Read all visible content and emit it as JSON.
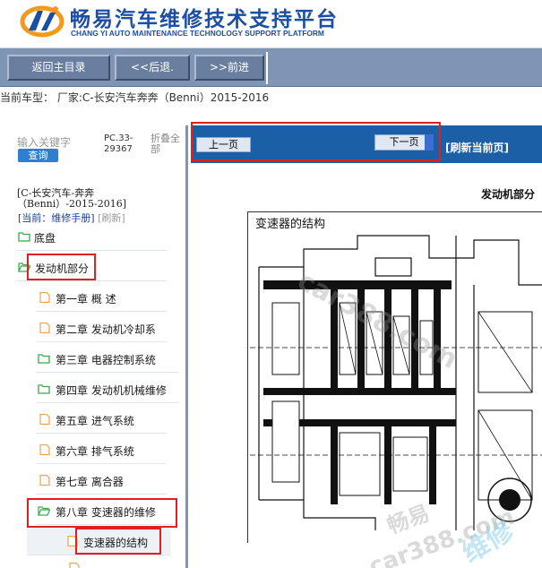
{
  "header": {
    "title": "畅易汽车维修技术支持平台",
    "subtitle": "CHANG YI AUTO MAINTENANCE TECHNOLOGY SUPPORT PLATFORM"
  },
  "toolbar": {
    "home_label": "返回主目录",
    "back_label": "<<后退.",
    "forward_label": ">>前进"
  },
  "vehicle_line": "当前车型： 厂家:C-长安汽车奔奔（Benni）2015-2016",
  "left_panel": {
    "search_placeholder": "输入关键字",
    "search_button": "查询",
    "pc_code": "PC.33-29367",
    "collapse_label": "折叠全部",
    "manual_path": "[C-长安汽车-奔奔（Benni）-2015-2016]",
    "current_label": "[当前：维修手册]",
    "refresh_label": "[刷新]",
    "tree": [
      {
        "label": "底盘",
        "icon": "folder-green-icon"
      },
      {
        "label": "发动机部分",
        "icon": "folder-open-green-icon"
      },
      {
        "label": "第一章 概 述",
        "icon": "page-icon"
      },
      {
        "label": "第二章 发动机冷却系",
        "icon": "page-icon"
      },
      {
        "label": "第三章 电器控制系统",
        "icon": "folder-green-icon"
      },
      {
        "label": "第四章 发动机机械维修",
        "icon": "folder-green-icon"
      },
      {
        "label": "第五章 进气系统",
        "icon": "page-icon"
      },
      {
        "label": "第六章 排气系统",
        "icon": "page-icon"
      },
      {
        "label": "第七章 离合器",
        "icon": "page-icon"
      },
      {
        "label": "第八章 变速器的维修",
        "icon": "folder-open-green-icon"
      },
      {
        "label": "变速器的结构",
        "icon": "page-icon"
      }
    ]
  },
  "right_panel": {
    "prev_label": "上一页",
    "next_label": "下一页",
    "refresh_label": "[刷新当前页]",
    "section_heading": "发动机部分",
    "page_title": "变速器的结构"
  },
  "watermarks": [
    "car388.com",
    "畅易",
    "car388.com",
    "维修"
  ],
  "colors": {
    "brand_blue": "#1b4fa6",
    "toolbar": "#7e95b6",
    "nav_bar": "#1b5fa7",
    "highlight_red": "#e02020"
  }
}
